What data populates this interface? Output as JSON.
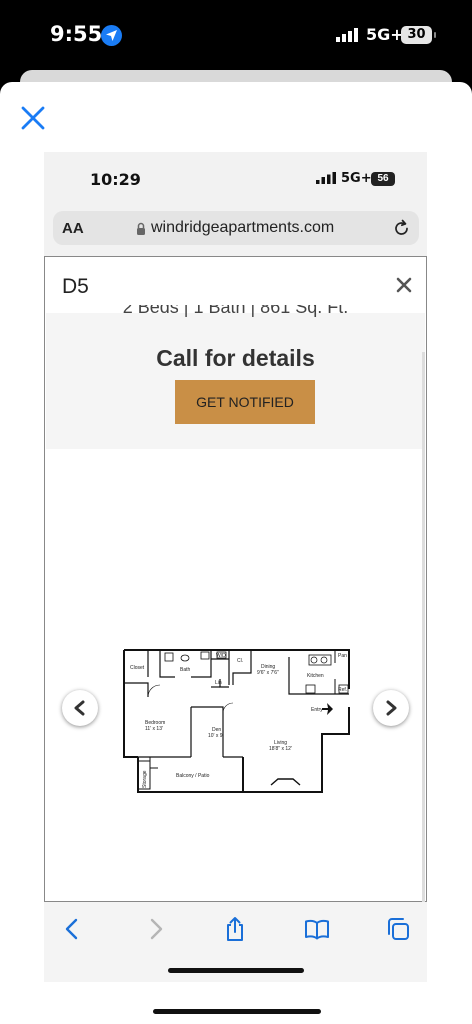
{
  "outer_status": {
    "time": "9:55",
    "network": "5G+",
    "battery": "30"
  },
  "inner_status": {
    "time": "10:29",
    "network": "5G+",
    "battery": "56"
  },
  "browser": {
    "text_size_label": "AA",
    "url": "windridgeapartments.com"
  },
  "modal": {
    "title": "D5",
    "details_line": "2 Beds | 1 Bath | 861 Sq. Ft.",
    "call_text": "Call for details",
    "notify_button": "GET NOTIFIED"
  },
  "floorplan_labels": {
    "closet": "Closet",
    "bath": "Bath",
    "wd": "W/D",
    "cl": "Cl.",
    "lin": "Lin",
    "dining": "Dining",
    "dining_size": "9'6\" x 7'6\"",
    "kitchen": "Kitchen",
    "pantry": "Pan",
    "ref": "Ref.",
    "entry": "Entry",
    "bedroom": "Bedroom",
    "bedroom_size": "11' x 13'",
    "den": "Den",
    "den_size": "10' x 9'",
    "living": "Living",
    "living_size": "18'8\" x 12'",
    "storage": "Storage",
    "balcony": "Balcony / Patio"
  },
  "colors": {
    "accent_button": "#c98f46",
    "location_blue": "#1a7cf5",
    "toolbar_blue": "#1a6fd8"
  },
  "icons": [
    "location-arrow-icon",
    "signal-icon",
    "close-icon",
    "lock-icon",
    "reload-icon",
    "chevron-left-icon",
    "chevron-right-icon",
    "back-icon",
    "forward-icon",
    "share-icon",
    "bookmarks-icon",
    "tabs-icon"
  ]
}
